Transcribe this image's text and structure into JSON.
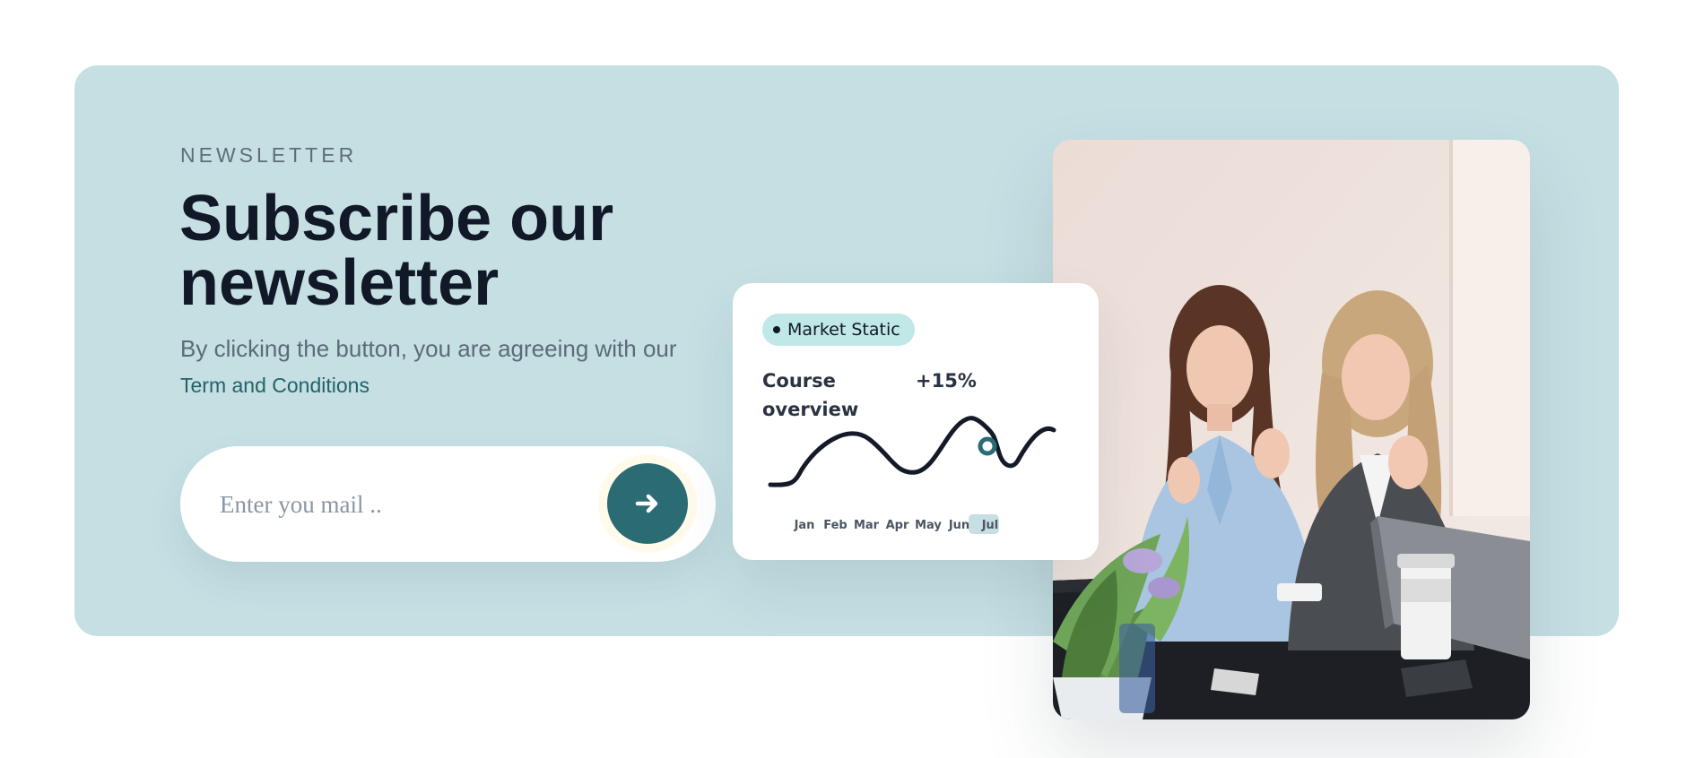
{
  "newsletter": {
    "eyebrow": "NEWSLETTER",
    "headline": "Subscribe our newsletter",
    "subtext": "By clicking the button, you are agreeing with our",
    "terms_link": "Term and Conditions"
  },
  "email_form": {
    "placeholder": "Enter you mail ..",
    "value": "",
    "submit_icon": "arrow-right-icon"
  },
  "stats_card": {
    "pill_label": "Market Static",
    "title": "Course overview",
    "growth": "+15%",
    "chart_data": {
      "type": "line",
      "categories": [
        "Jan",
        "Feb",
        "Mar",
        "Apr",
        "May",
        "Jun",
        "Jul"
      ],
      "highlighted_category": "Jun",
      "line_color": "#151a29",
      "marker_color": "#2b6b74"
    }
  },
  "photo": {
    "alt": "Two women talking at a meeting table"
  },
  "colors": {
    "banner_bg": "#c5dfe3",
    "accent": "#2b6b74",
    "link": "#21636a",
    "pill_bg": "#bfe8e6"
  }
}
